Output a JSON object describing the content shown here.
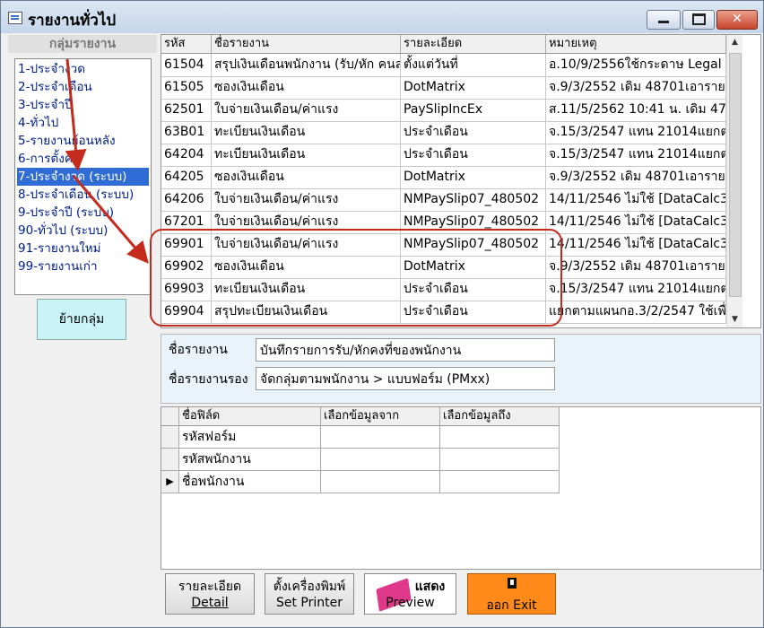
{
  "window": {
    "title": "รายงานทั่วไป"
  },
  "groups": {
    "header": "กลุ่มรายงาน",
    "items": [
      "1-ประจำงวด",
      "2-ประจำเดือน",
      "3-ประจำปี",
      "4-ทั่วไป",
      "5-รายงานย้อนหลัง",
      "6-การตั้งค่า",
      "7-ประจำงวด (ระบบ)",
      "8-ประจำเดือน (ระบบ)",
      "9-ประจำปี (ระบบ)",
      "90-ทั่วไป (ระบบ)",
      "91-รายงานใหม่",
      "99-รายงานเก่า"
    ],
    "selected_index": 6,
    "move_button": "ย้ายกลุ่ม"
  },
  "report_grid": {
    "columns": [
      "รหัส",
      "ชื่อรายงาน",
      "รายละเอียด",
      "หมายเหตุ"
    ],
    "rows": [
      [
        "61504",
        "สรุปเงินเดือนพนักงาน (รับ/หัก คนล",
        "ตั้งแต่วันที่",
        "อ.10/9/2556ใช้กระดาษ Legal แ"
      ],
      [
        "61505",
        "ซองเงินเดือน",
        "DotMatrix",
        "จ.9/3/2552 เดิม 48701เอารายก"
      ],
      [
        "62501",
        "ใบจ่ายเงินเดือน/ค่าแรง",
        "PaySlipIncEx",
        "ส.11/5/2562  10:41 น. เดิม 47"
      ],
      [
        "63B01",
        "ทะเบียนเงินเดือน",
        "ประจำเดือน",
        "จ.15/3/2547 แทน 21014แยกต"
      ],
      [
        "64204",
        "ทะเบียนเงินเดือน",
        "ประจำเดือน",
        "จ.15/3/2547 แทน 21014แยกต"
      ],
      [
        "64205",
        "ซองเงินเดือน",
        "DotMatrix",
        "จ.9/3/2552 เดิม 48701เอารายก"
      ],
      [
        "64206",
        "ใบจ่ายเงินเดือน/ค่าแรง",
        "NMPaySlip07_480502",
        "14/11/2546 ไม่ใช้ [DataCalc3"
      ],
      [
        "67201",
        "ใบจ่ายเงินเดือน/ค่าแรง",
        "NMPaySlip07_480502",
        "14/11/2546 ไม่ใช้ [DataCalc3"
      ],
      [
        "69901",
        "ใบจ่ายเงินเดือน/ค่าแรง",
        "NMPaySlip07_480502",
        "14/11/2546 ไม่ใช้ [DataCalc3"
      ],
      [
        "69902",
        "ซองเงินเดือน",
        "DotMatrix",
        "จ.9/3/2552 เดิม 48701เอารายก"
      ],
      [
        "69903",
        "ทะเบียนเงินเดือน",
        "ประจำเดือน",
        "จ.15/3/2547 แทน 21014แยกต"
      ],
      [
        "69904",
        "สรุปทะเบียนเงินเดือน",
        "ประจำเดือน",
        "แยกตามแผนกอ.3/2/2547 ใช้เพื่"
      ]
    ]
  },
  "detail": {
    "report_name_label": "ชื่อรายงาน",
    "report_name_value": "บันทึกรายการรับ/หักคงที่ของพนักงาน",
    "sub_name_label": "ชื่อรายงานรอง",
    "sub_name_value": "จัดกลุ่มตามพนักงาน > แบบฟอร์ม (PMxx)"
  },
  "field_grid": {
    "columns": [
      "ชื่อฟิล์ด",
      "เลือกข้อมูลจาก",
      "เลือกข้อมูลถึง"
    ],
    "rows": [
      {
        "name": "รหัสฟอร์ม",
        "from": "",
        "to": "",
        "current": false
      },
      {
        "name": "รหัสพนักงาน",
        "from": "",
        "to": "",
        "current": false
      },
      {
        "name": "ชื่อพนักงาน",
        "from": "",
        "to": "",
        "current": true
      }
    ]
  },
  "buttons": {
    "detail_th": "รายละเอียด",
    "detail_en": "Detail",
    "printer_th": "ตั้งเครื่องพิมพ์",
    "printer_en": "Set Printer",
    "preview_th": "แสดง",
    "preview_en": "Preview",
    "exit": "ออก  Exit"
  },
  "colors": {
    "selected": "#2f6cd6",
    "highlight": "#c42b1c",
    "exit_button": "#ff8a1a",
    "group_text": "#00208c"
  }
}
